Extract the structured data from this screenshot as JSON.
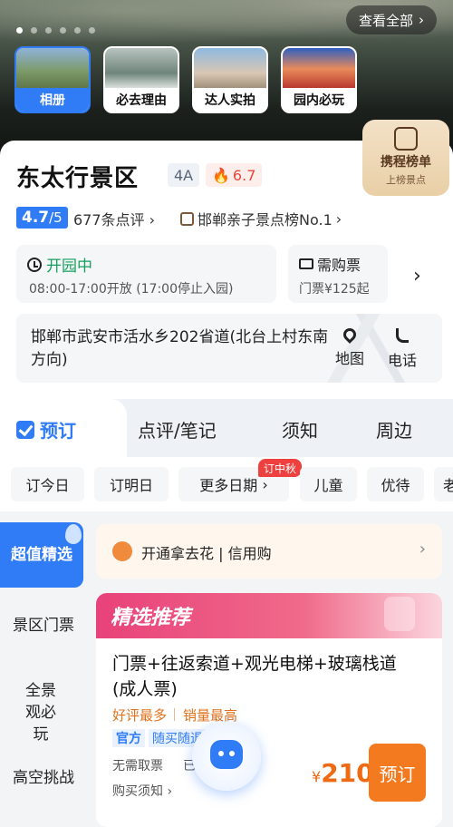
{
  "hero": {
    "view_all": "查看全部",
    "thumbs": [
      {
        "label": "相册",
        "active": true
      },
      {
        "label": "必去理由",
        "active": false
      },
      {
        "label": "达人实拍",
        "active": false
      },
      {
        "label": "园内必玩",
        "active": false
      }
    ],
    "dot_count": 6,
    "active_dot": 0
  },
  "scenic": {
    "title": "东太行景区",
    "grade": "4A",
    "hot": "6.7",
    "rank_badge": {
      "line1": "携程榜单",
      "line2": "上榜景点"
    },
    "score": "4.7",
    "score_total": "/5",
    "reviews": "677条点评",
    "list_rank": "邯郸亲子景点榜No.1"
  },
  "status": {
    "open": "开园中",
    "hours": "08:00-17:00开放 (17:00停止入园)",
    "ticket_title": "需购票",
    "ticket_price": "门票¥125起"
  },
  "address": {
    "text": "邯郸市武安市活水乡202省道(北台上村东南方向)",
    "map": "地图",
    "call": "电话"
  },
  "tabs": [
    "预订",
    "点评/笔记",
    "须知",
    "周边"
  ],
  "chips": {
    "items": [
      "订今日",
      "订明日",
      "更多日期",
      "儿童",
      "优待",
      "老"
    ],
    "mid_autumn": "订中秋"
  },
  "sidebar": [
    "超值精选",
    "景区门票",
    "全景观必玩",
    "高空挑战"
  ],
  "huabei": "开通拿去花 | 信用购",
  "rec": {
    "header": "精选推荐",
    "title": "门票+往返索道+观光电梯+玻璃栈道(成人票)",
    "tag1": "好评最多",
    "tag2": "销量最高",
    "official": "官方",
    "anytime": "随买随退",
    "no_ticket": "无需取票",
    "sold": "已",
    "buy_notice": "购买须知",
    "currency": "¥",
    "price": "210",
    "book": "预订"
  },
  "colors": {
    "primary": "#2f7cf6",
    "orange": "#f47a20",
    "pink": "#e8427a",
    "green": "#17a05d"
  }
}
